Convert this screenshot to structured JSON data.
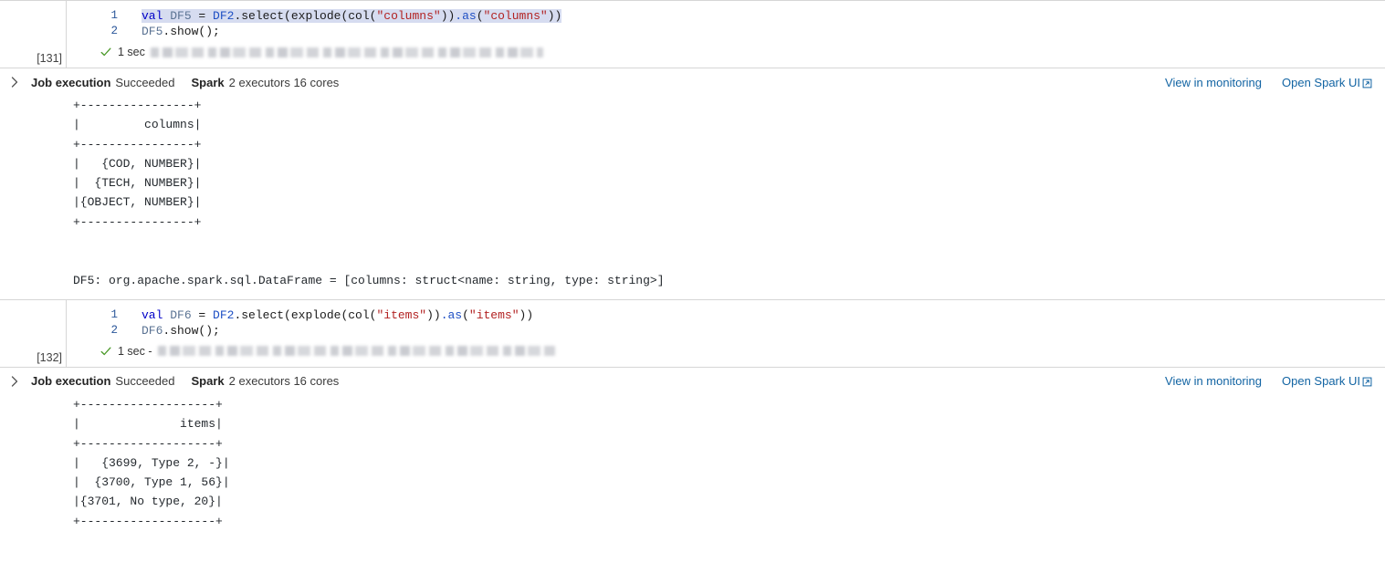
{
  "colors": {
    "link": "#1264a3",
    "success_check": "#4c9a2a",
    "keyword": "#0000c8",
    "string": "#b22222",
    "selection": "#d6dcf0",
    "border": "#d6d6d6"
  },
  "cells": [
    {
      "execution_count": "[131]",
      "code_lines": [
        {
          "number": "1",
          "selected": true,
          "tokens": [
            {
              "t": "val",
              "c": "kw"
            },
            {
              "t": " ",
              "c": "pl"
            },
            {
              "t": "DF5",
              "c": "var"
            },
            {
              "t": " = ",
              "c": "pl"
            },
            {
              "t": "DF2",
              "c": "fn"
            },
            {
              "t": ".select(explode(",
              "c": "pl"
            },
            {
              "t": "col",
              "c": "pl"
            },
            {
              "t": "(",
              "c": "pl"
            },
            {
              "t": "\"columns\"",
              "c": "str"
            },
            {
              "t": "))",
              "c": "pl"
            },
            {
              "t": ".as",
              "c": "fn"
            },
            {
              "t": "(",
              "c": "pl"
            },
            {
              "t": "\"columns\"",
              "c": "str"
            },
            {
              "t": "))",
              "c": "pl"
            }
          ]
        },
        {
          "number": "2",
          "selected": false,
          "tokens": [
            {
              "t": "DF5",
              "c": "var"
            },
            {
              "t": ".show();",
              "c": "pl"
            }
          ]
        }
      ],
      "status": {
        "icon": "success-check-icon",
        "duration": "1 sec",
        "redacted_width": 430
      },
      "job": {
        "chevron": "chevron-right-icon",
        "label": "Job execution",
        "value": "Succeeded",
        "engine_label": "Spark",
        "engine_value": "2 executors 16 cores",
        "links": [
          {
            "text": "View in monitoring",
            "external": false
          },
          {
            "text": "Open Spark UI",
            "external": true
          }
        ]
      },
      "output": "+----------------+\n|         columns|\n+----------------+\n|   {COD, NUMBER}|\n|  {TECH, NUMBER}|\n|{OBJECT, NUMBER}|\n+----------------+\n\n\nDF5: org.apache.spark.sql.DataFrame = [columns: struct<name: string, type: string>]"
    },
    {
      "execution_count": "[132]",
      "code_lines": [
        {
          "number": "1",
          "selected": false,
          "tokens": [
            {
              "t": "val",
              "c": "kw"
            },
            {
              "t": " ",
              "c": "pl"
            },
            {
              "t": "DF6",
              "c": "var"
            },
            {
              "t": " = ",
              "c": "pl"
            },
            {
              "t": "DF2",
              "c": "fn"
            },
            {
              "t": ".select(explode(",
              "c": "pl"
            },
            {
              "t": "col",
              "c": "pl"
            },
            {
              "t": "(",
              "c": "pl"
            },
            {
              "t": "\"items\"",
              "c": "str"
            },
            {
              "t": "))",
              "c": "pl"
            },
            {
              "t": ".as",
              "c": "fn"
            },
            {
              "t": "(",
              "c": "pl"
            },
            {
              "t": "\"items\"",
              "c": "str"
            },
            {
              "t": "))",
              "c": "pl"
            }
          ]
        },
        {
          "number": "2",
          "selected": false,
          "tokens": [
            {
              "t": "DF6",
              "c": "var"
            },
            {
              "t": ".show();",
              "c": "pl"
            }
          ]
        }
      ],
      "status": {
        "icon": "success-check-icon",
        "duration": "1 sec -",
        "redacted_width": 435
      },
      "job": {
        "chevron": "chevron-right-icon",
        "label": "Job execution",
        "value": "Succeeded",
        "engine_label": "Spark",
        "engine_value": "2 executors 16 cores",
        "links": [
          {
            "text": "View in monitoring",
            "external": false
          },
          {
            "text": "Open Spark UI",
            "external": true
          }
        ]
      },
      "output": "+-------------------+\n|              items|\n+-------------------+\n|   {3699, Type 2, -}|\n|  {3700, Type 1, 56}|\n|{3701, No type, 20}|\n+-------------------+"
    }
  ]
}
